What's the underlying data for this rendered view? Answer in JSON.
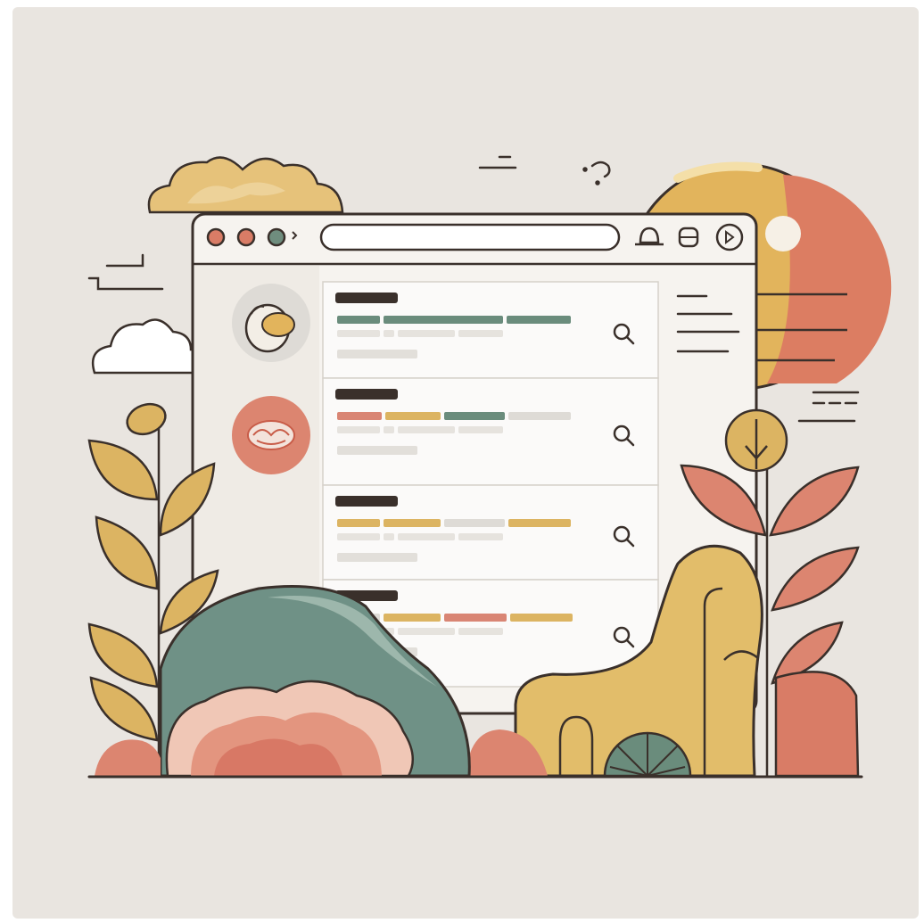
{
  "palette": {
    "background": "#e9e5e0",
    "window": "#f6f3ef",
    "card": "#fbfaf9",
    "outline": "#3a302b",
    "dark_bar": "#3a302b",
    "teal": "#6a8c7c",
    "mustard": "#dcb462",
    "coral": "#d98574",
    "light_gray": "#dedbd6",
    "sun_gold": "#e2b45c",
    "sun_coral": "#dc7d62"
  },
  "browser": {
    "traffic_lights": [
      "#d97c66",
      "#d97c66",
      "#6f8d7e"
    ],
    "address_value": "",
    "toolbar_icons": [
      "bell-icon",
      "lock-icon",
      "play-icon"
    ]
  },
  "results": [
    {
      "avatar": "egg-icon",
      "bars": [
        "teal",
        "teal",
        "teal"
      ],
      "action_icon": "search-icon"
    },
    {
      "avatar": "cloud-badge-icon",
      "bars": [
        "coral",
        "mustard",
        "teal",
        "light_gray"
      ],
      "action_icon": "search-icon"
    },
    {
      "avatar": "",
      "bars": [
        "mustard",
        "mustard",
        "light_gray",
        "mustard"
      ],
      "action_icon": "search-icon"
    },
    {
      "avatar": "",
      "bars": [
        "light_gray",
        "mustard",
        "coral",
        "mustard"
      ],
      "action_icon": "search-icon"
    }
  ],
  "decorations": [
    "cloud-icon",
    "sun-icon",
    "plant-left-icon",
    "plant-right-icon",
    "hill-icon",
    "tree-icon"
  ]
}
